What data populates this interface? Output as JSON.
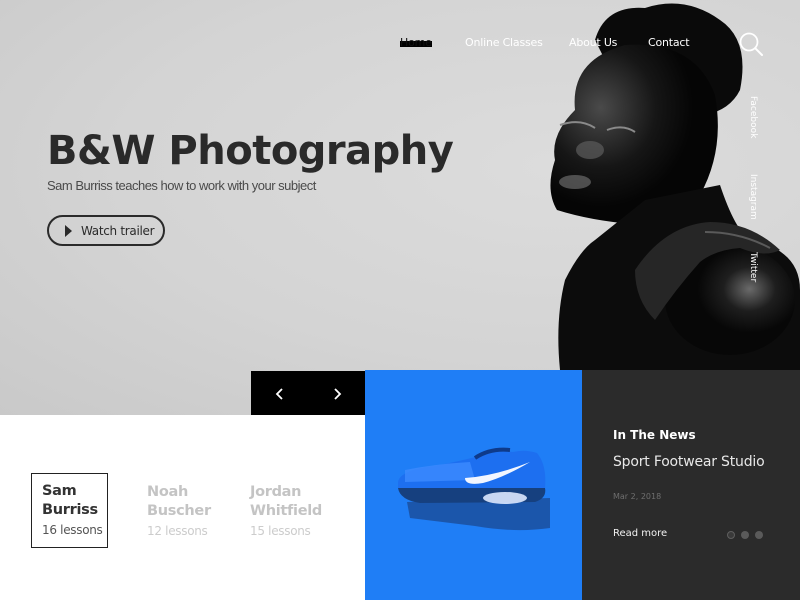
{
  "nav": {
    "items": [
      {
        "label": "Home",
        "active": true
      },
      {
        "label": "Online Classes",
        "active": false
      },
      {
        "label": "About Us",
        "active": false
      },
      {
        "label": "Contact",
        "active": false
      }
    ],
    "search_icon": "search-icon"
  },
  "social": [
    "Facebook",
    "Instagram",
    "Twitter"
  ],
  "hero": {
    "title": "B&W Photography",
    "subtitle": "Sam Burriss teaches how to work with your subject",
    "cta_label": "Watch trailer",
    "cta_icon": "play-icon",
    "image": "black-and-white-portrait"
  },
  "slider": {
    "prev_icon": "chevron-left-icon",
    "next_icon": "chevron-right-icon"
  },
  "teachers": [
    {
      "first": "Sam",
      "last": "Burriss",
      "lessons": "16 lessons",
      "selected": true
    },
    {
      "first": "Noah",
      "last": "Buscher",
      "lessons": "12 lessons",
      "selected": false
    },
    {
      "first": "Jordan",
      "last": "Whitfield",
      "lessons": "15 lessons",
      "selected": false
    }
  ],
  "product": {
    "image": "blue-sneaker",
    "background": "#1f7ef6"
  },
  "news": {
    "label": "In The News",
    "title": "Sport Footwear Studio",
    "date": "Mar 2, 2018",
    "read_more": "Read more",
    "dots": 3,
    "active_dot": 0
  }
}
